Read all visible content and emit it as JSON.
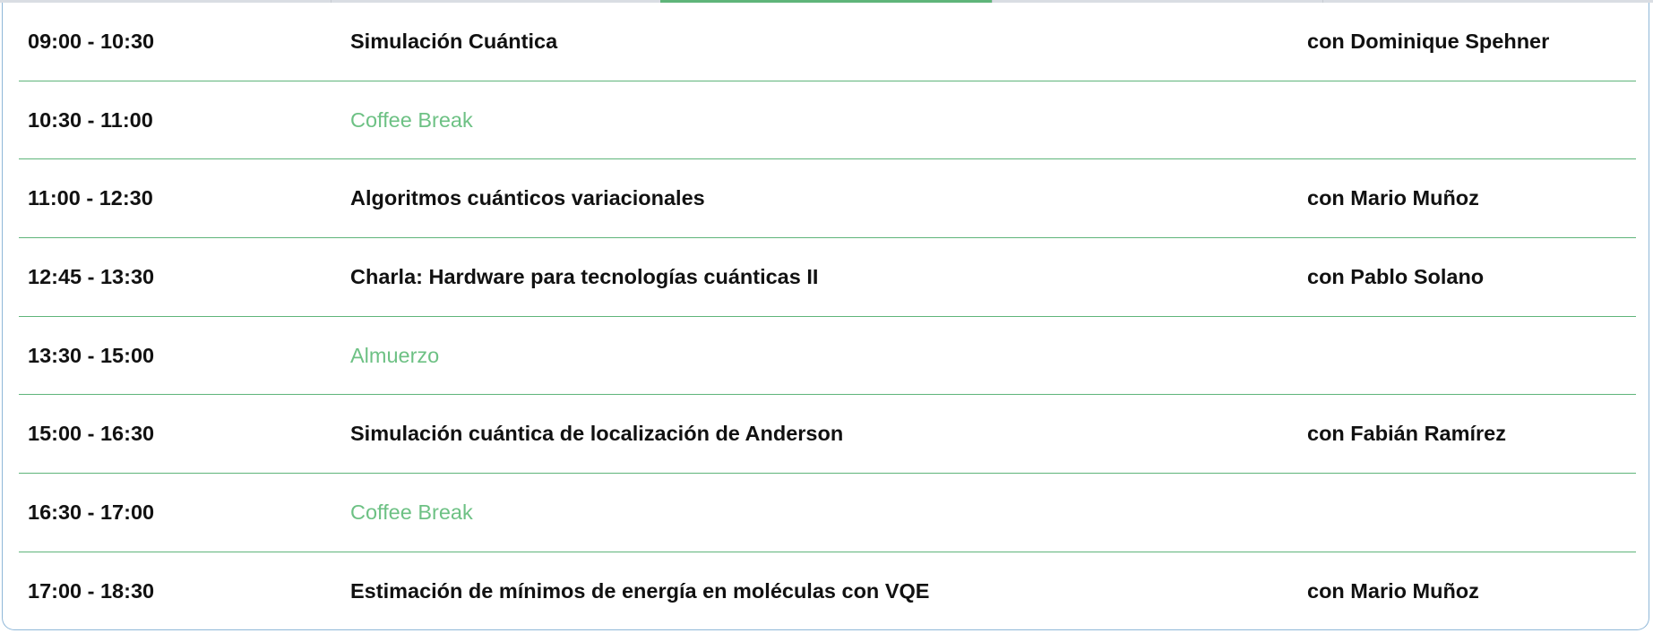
{
  "schedule": {
    "rows": [
      {
        "time": "09:00 - 10:30",
        "title": "Simulación Cuántica",
        "speaker": "con Dominique Spehner",
        "type": "session"
      },
      {
        "time": "10:30 - 11:00",
        "title": "Coffee Break",
        "speaker": "",
        "type": "break"
      },
      {
        "time": "11:00 - 12:30",
        "title": "Algoritmos cuánticos variacionales",
        "speaker": "con Mario Muñoz",
        "type": "session"
      },
      {
        "time": "12:45 - 13:30",
        "title": "Charla: Hardware para tecnologías cuánticas II",
        "speaker": "con Pablo Solano",
        "type": "session"
      },
      {
        "time": "13:30 - 15:00",
        "title": "Almuerzo",
        "speaker": "",
        "type": "break"
      },
      {
        "time": "15:00 - 16:30",
        "title": "Simulación cuántica de localización de Anderson",
        "speaker": "con Fabián Ramírez",
        "type": "session"
      },
      {
        "time": "16:30 - 17:00",
        "title": "Coffee Break",
        "speaker": "",
        "type": "break"
      },
      {
        "time": "17:00 - 18:30",
        "title": "Estimación de mínimos de energía en moléculas con VQE",
        "speaker": "con Mario Muñoz",
        "type": "session"
      }
    ]
  },
  "colors": {
    "accent_green": "#5fb57a",
    "break_text_green": "#6dc184",
    "panel_border_blue": "#8fb7d8",
    "text_dark": "#111111"
  }
}
